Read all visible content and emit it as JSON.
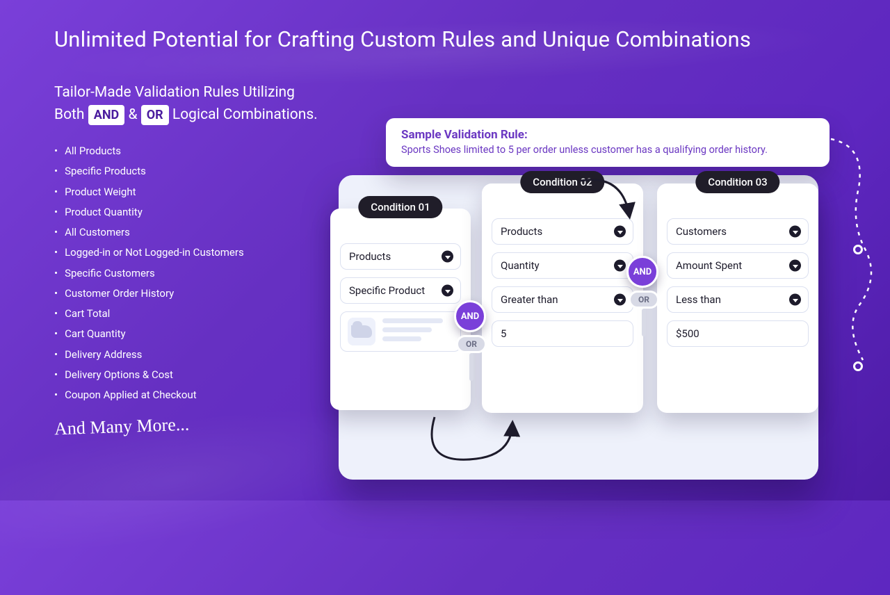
{
  "headline": "Unlimited Potential for Crafting Custom Rules and Unique Combinations",
  "subhead": {
    "line1_a": "Tailor-Made Validation Rules Utilizing",
    "line2_a": "Both ",
    "and": "AND",
    "amp": " & ",
    "or": "OR",
    "line2_b": " Logical Combinations."
  },
  "bullets": [
    "All Products",
    "Specific Products",
    "Product Weight",
    "Product Quantity",
    "All Customers",
    "Logged-in or Not Logged-in Customers",
    "Specific Customers",
    "Customer Order History",
    "Cart Total",
    "Cart Quantity",
    "Delivery Address",
    "Delivery Options & Cost",
    "Coupon Applied at Checkout"
  ],
  "script_text": "And Many More...",
  "sample": {
    "title": "Sample Validation Rule:",
    "desc": "Sports Shoes limited to 5 per order unless customer has a qualifying order history."
  },
  "joiners": {
    "and": "AND",
    "or": "OR"
  },
  "conditions": {
    "c1": {
      "tab": "Condition 01",
      "f1": "Products",
      "f2": "Specific Product"
    },
    "c2": {
      "tab": "Condition 02",
      "f1": "Products",
      "f2": "Quantity",
      "f3": "Greater than",
      "f4": "5"
    },
    "c3": {
      "tab": "Condition 03",
      "f1": "Customers",
      "f2": "Amount Spent",
      "f3": "Less than",
      "f4": "$500"
    }
  }
}
